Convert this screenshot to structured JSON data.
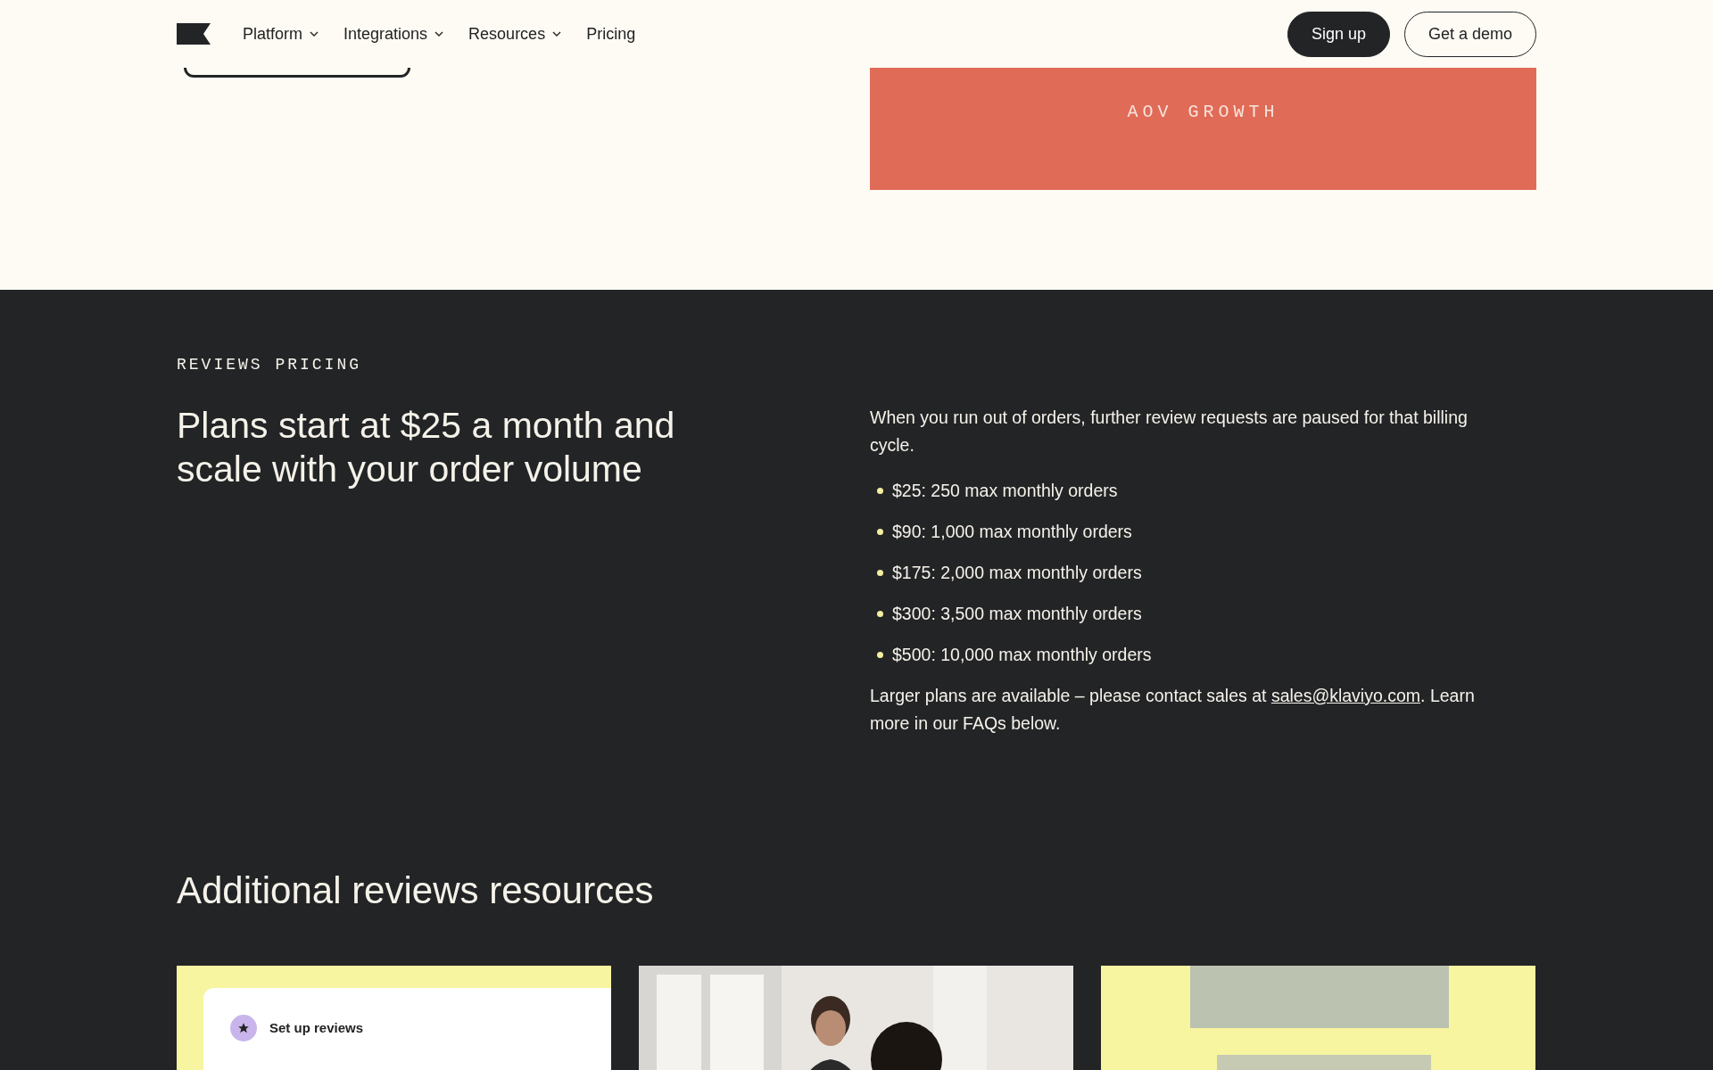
{
  "nav": {
    "items": [
      {
        "label": "Platform",
        "has_menu": true
      },
      {
        "label": "Integrations",
        "has_menu": true
      },
      {
        "label": "Resources",
        "has_menu": true
      },
      {
        "label": "Pricing",
        "has_menu": false
      }
    ],
    "buttons": [
      {
        "label": "Sign up",
        "kind": "filled"
      },
      {
        "label": "Get a demo",
        "kind": "outline"
      }
    ]
  },
  "hero": {
    "stat_label": "AOV GROWTH"
  },
  "pricing": {
    "eyebrow": "REVIEWS PRICING",
    "heading": "Plans start at $25 a month and scale with your order volume",
    "intro": "When you run out of orders, further review requests are paused for that billing cycle.",
    "tiers": [
      "$25: 250 max monthly orders",
      "$90: 1,000 max monthly orders",
      "$175: 2,000 max monthly orders",
      "$300: 3,500 max monthly orders",
      "$500: 10,000 max monthly orders"
    ],
    "footer_before": "Larger plans are available – please contact sales at ",
    "footer_link": "sales@klaviyo.com",
    "footer_after": ". Learn more in our FAQs below."
  },
  "resources": {
    "heading": "Additional reviews resources",
    "cards": [
      {
        "kind": "ui",
        "label": "Set up reviews"
      },
      {
        "kind": "picture"
      },
      {
        "kind": "picture"
      }
    ]
  }
}
